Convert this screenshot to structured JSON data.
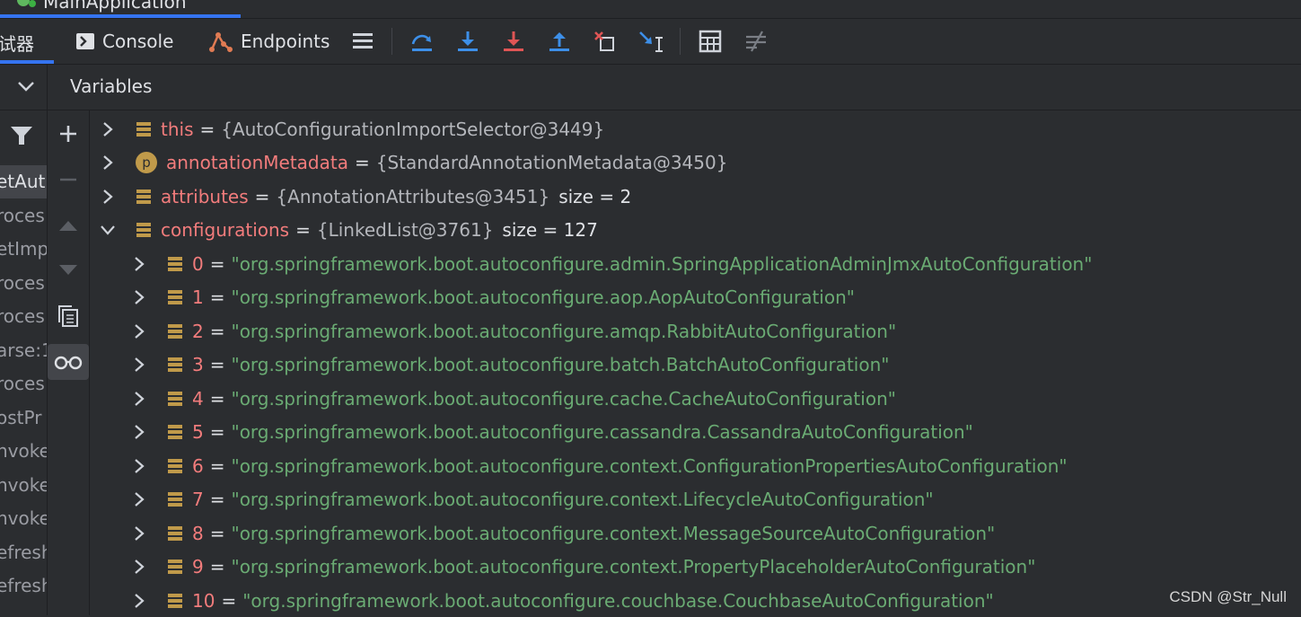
{
  "run_tab": {
    "title": "MainApplication"
  },
  "toolbar": {
    "debugger_label": "试器",
    "console_label": "Console",
    "endpoints_label": "Endpoints"
  },
  "variables_header": {
    "title": "Variables"
  },
  "frames": [
    {
      "label": "etAut",
      "selected": true
    },
    {
      "label": "roces",
      "selected": false
    },
    {
      "label": "etImp",
      "selected": false
    },
    {
      "label": "roces",
      "selected": false
    },
    {
      "label": "roces",
      "selected": false
    },
    {
      "label": "arse:1",
      "selected": false
    },
    {
      "label": "roces",
      "selected": false
    },
    {
      "label": "ostPr",
      "selected": false
    },
    {
      "label": "nvoke",
      "selected": false
    },
    {
      "label": "nvoke",
      "selected": false
    },
    {
      "label": "nvoke",
      "selected": false
    },
    {
      "label": "efresh",
      "selected": false
    },
    {
      "label": "efresh",
      "selected": false
    }
  ],
  "variables": {
    "this": {
      "name": "this",
      "eq": "=",
      "value": "{AutoConfigurationImportSelector@3449}"
    },
    "annotationMetadata": {
      "name": "annotationMetadata",
      "eq": "=",
      "value": "{StandardAnnotationMetadata@3450}",
      "badge": "p"
    },
    "attributes": {
      "name": "attributes",
      "eq": "=",
      "value": "{AnnotationAttributes@3451}",
      "size": "size = 2"
    },
    "configurations": {
      "name": "configurations",
      "eq": "=",
      "value": "{LinkedList@3761}",
      "size": "size = 127"
    },
    "items": [
      {
        "index": "0",
        "eq": "=",
        "value": "\"org.springframework.boot.autoconfigure.admin.SpringApplicationAdminJmxAutoConfiguration\""
      },
      {
        "index": "1",
        "eq": "=",
        "value": "\"org.springframework.boot.autoconfigure.aop.AopAutoConfiguration\""
      },
      {
        "index": "2",
        "eq": "=",
        "value": "\"org.springframework.boot.autoconfigure.amqp.RabbitAutoConfiguration\""
      },
      {
        "index": "3",
        "eq": "=",
        "value": "\"org.springframework.boot.autoconfigure.batch.BatchAutoConfiguration\""
      },
      {
        "index": "4",
        "eq": "=",
        "value": "\"org.springframework.boot.autoconfigure.cache.CacheAutoConfiguration\""
      },
      {
        "index": "5",
        "eq": "=",
        "value": "\"org.springframework.boot.autoconfigure.cassandra.CassandraAutoConfiguration\""
      },
      {
        "index": "6",
        "eq": "=",
        "value": "\"org.springframework.boot.autoconfigure.context.ConfigurationPropertiesAutoConfiguration\""
      },
      {
        "index": "7",
        "eq": "=",
        "value": "\"org.springframework.boot.autoconfigure.context.LifecycleAutoConfiguration\""
      },
      {
        "index": "8",
        "eq": "=",
        "value": "\"org.springframework.boot.autoconfigure.context.MessageSourceAutoConfiguration\""
      },
      {
        "index": "9",
        "eq": "=",
        "value": "\"org.springframework.boot.autoconfigure.context.PropertyPlaceholderAutoConfiguration\""
      },
      {
        "index": "10",
        "eq": "=",
        "value": "\"org.springframework.boot.autoconfigure.couchbase.CouchbaseAutoConfiguration\""
      }
    ]
  },
  "watermark": "CSDN @Str_Null",
  "colors": {
    "background": "#2b2d30",
    "accent": "#3574f0",
    "variable_name": "#f27c7c",
    "string_value": "#6aab73",
    "field_icon": "#c09a4a",
    "step_icon": "#3d8fe8",
    "force_step_icon": "#e05555"
  },
  "icons": {
    "console": "console-icon",
    "endpoints": "endpoints-icon",
    "frames_menu": "hamburger-menu-icon",
    "step_over": "step-over-icon",
    "step_into": "step-into-icon",
    "force_step_into": "force-step-into-icon",
    "step_out": "step-out-icon",
    "drop_frame": "drop-frame-icon",
    "run_to_cursor": "run-to-cursor-icon",
    "evaluate": "evaluate-expression-icon",
    "trace": "trace-icon",
    "filter": "filter-icon",
    "add_watch": "plus-icon",
    "remove_watch": "minus-icon",
    "move_up": "arrow-up-icon",
    "move_down": "arrow-down-icon",
    "copy": "copy-icon",
    "watches_glasses": "glasses-icon"
  }
}
